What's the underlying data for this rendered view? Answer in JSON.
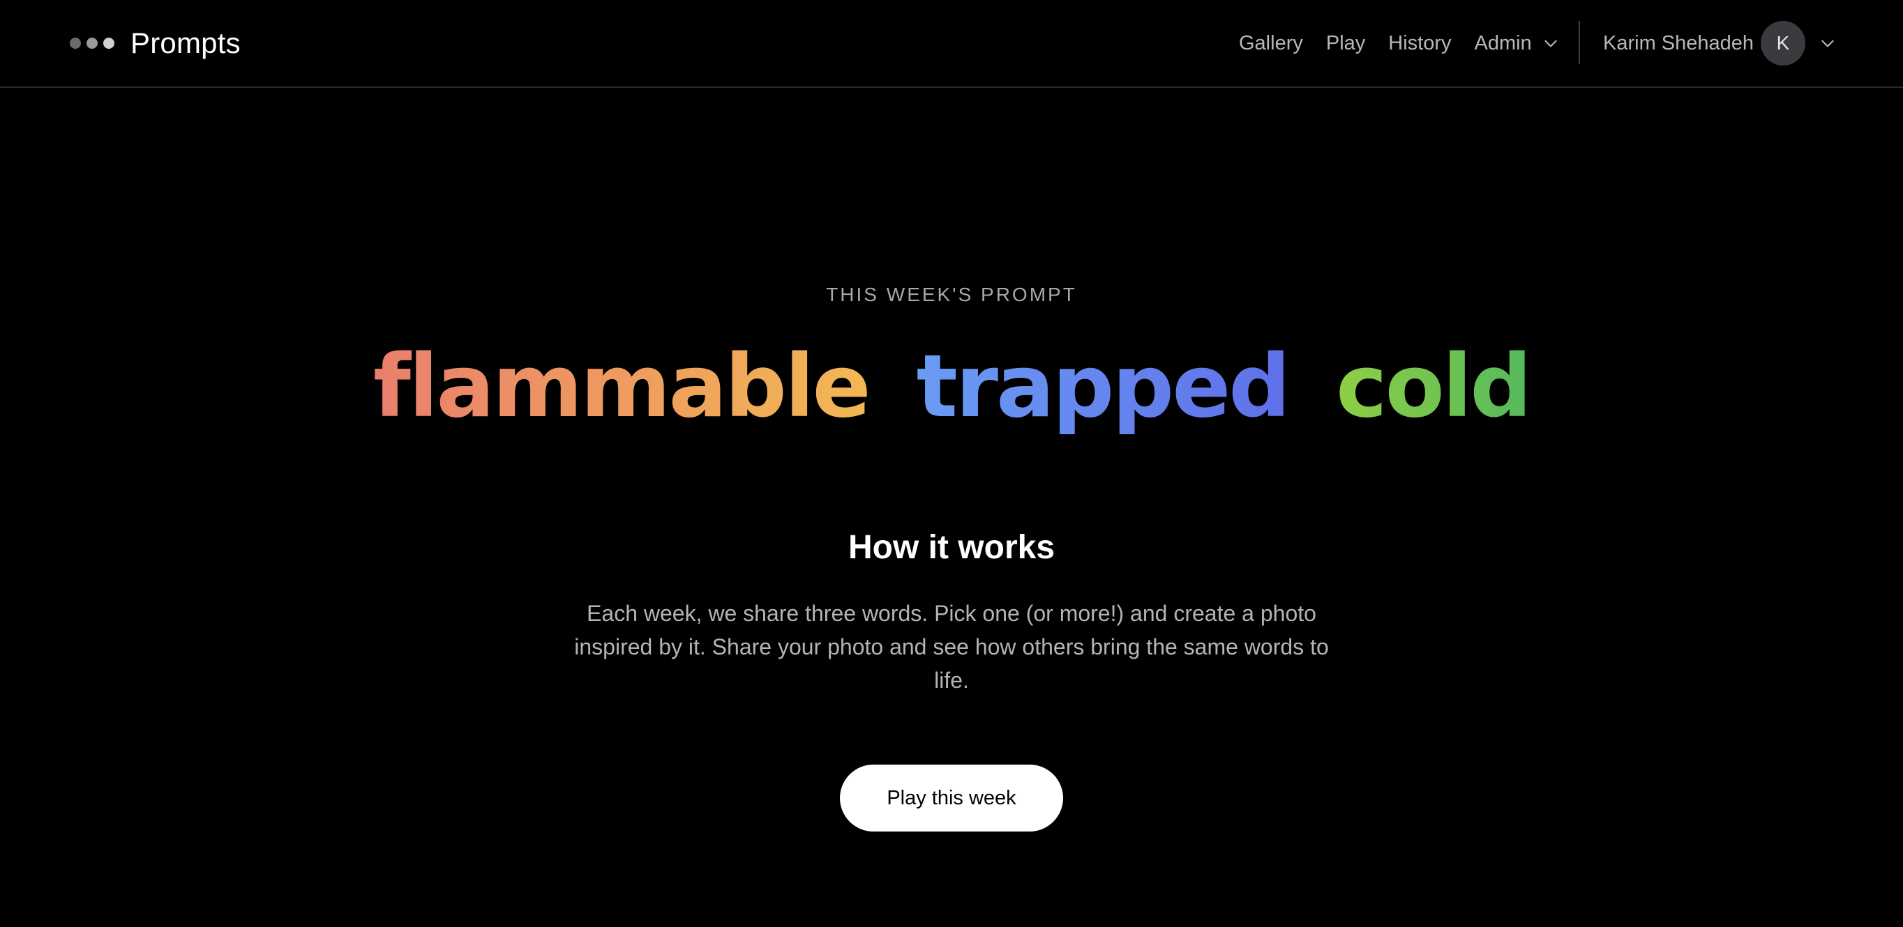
{
  "header": {
    "app_title": "Prompts",
    "logo_dot_colors": [
      "#6b6b6b",
      "#9a9a9a",
      "#d0d0d0"
    ],
    "nav": {
      "gallery": "Gallery",
      "play": "Play",
      "history": "History",
      "admin": "Admin"
    },
    "user": {
      "name": "Karim Shehadeh",
      "initial": "K"
    }
  },
  "hero": {
    "kicker": "THIS WEEK'S PROMPT",
    "words": [
      "flammable",
      "trapped",
      "cold"
    ],
    "word_colors": [
      [
        "#ea7f6c",
        "#f2b853"
      ],
      [
        "#6a9cf3",
        "#5f70e9"
      ],
      [
        "#8fcf45",
        "#55b95b"
      ]
    ]
  },
  "how_it_works": {
    "title": "How it works",
    "description": "Each week, we share three words. Pick one (or more!) and create a photo inspired by it. Share your photo and see how others bring the same words to life."
  },
  "cta": {
    "label": "Play this week"
  },
  "icons": {
    "logo": "three-dots-logo-icon",
    "admin_menu": "chevron-down-icon",
    "user_menu": "chevron-down-icon"
  },
  "colors": {
    "background": "#000000",
    "text_primary": "#ffffff",
    "text_muted": "#b8b8b8",
    "button_bg": "#ffffff",
    "button_text": "#000000"
  }
}
